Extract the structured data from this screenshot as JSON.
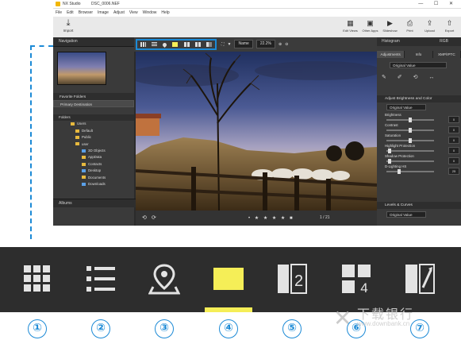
{
  "window": {
    "app_name": "NX Studio",
    "file_name": "DSC_0006.NEF",
    "controls": "— ☐ ✕"
  },
  "menu": [
    "File",
    "Edit",
    "Browser",
    "Image",
    "Adjust",
    "View",
    "Window",
    "Help"
  ],
  "toolbar": {
    "import_label": "Import",
    "right_items": [
      "Edit Views",
      "Other Apps",
      "Slideshow",
      "Print",
      "Upload",
      "Export"
    ]
  },
  "left_panel": {
    "navigation_header": "Navigation",
    "favorites_header": "Favorite Folders",
    "favorite_item": "Primary Destination",
    "folders_header": "Folders",
    "folder_tree": [
      "Users",
      "Default",
      "Public",
      "user",
      "3D Objects",
      "AppData",
      "Contacts",
      "Desktop",
      "Documents",
      "Downloads"
    ],
    "albums_header": "Albums"
  },
  "view_bar": {
    "sort_label": "Name",
    "zoom_value": "22.2%"
  },
  "viewer": {
    "counter": "1 / 21",
    "rating": "• ★ ★ ★ ★ ■"
  },
  "right_panel": {
    "histogram_header": "Histogram",
    "histogram_channel": "RGB",
    "tabs": [
      "Adjustments",
      "Info",
      "XMP/IPTC"
    ],
    "preset_value": "Original Value",
    "section_title": "Adjust Brightness and Color",
    "section_value": "Original Value",
    "sliders": [
      {
        "label": "Brightness",
        "value": "0"
      },
      {
        "label": "Contrast",
        "value": "0"
      },
      {
        "label": "Saturation",
        "value": "0"
      },
      {
        "label": "Highlight Protection",
        "value": "0"
      },
      {
        "label": "Shadow Protection",
        "value": "0"
      },
      {
        "label": "D-Lighting HS",
        "value": "25"
      }
    ],
    "levels_header": "Levels & Curves",
    "levels_value": "Original Value"
  },
  "zoom_strip": {
    "icons": [
      "grid-view-icon",
      "list-view-icon",
      "map-pin-icon",
      "image-viewer-icon",
      "two-frame-icon",
      "four-frame-icon",
      "compare-icon"
    ],
    "active_color": "#f5ee57"
  },
  "callout_numbers": [
    "①",
    "②",
    "③",
    "④",
    "⑤",
    "⑥",
    "⑦"
  ],
  "watermark": {
    "title": "下载银行",
    "url": "www.downbank.cn"
  }
}
